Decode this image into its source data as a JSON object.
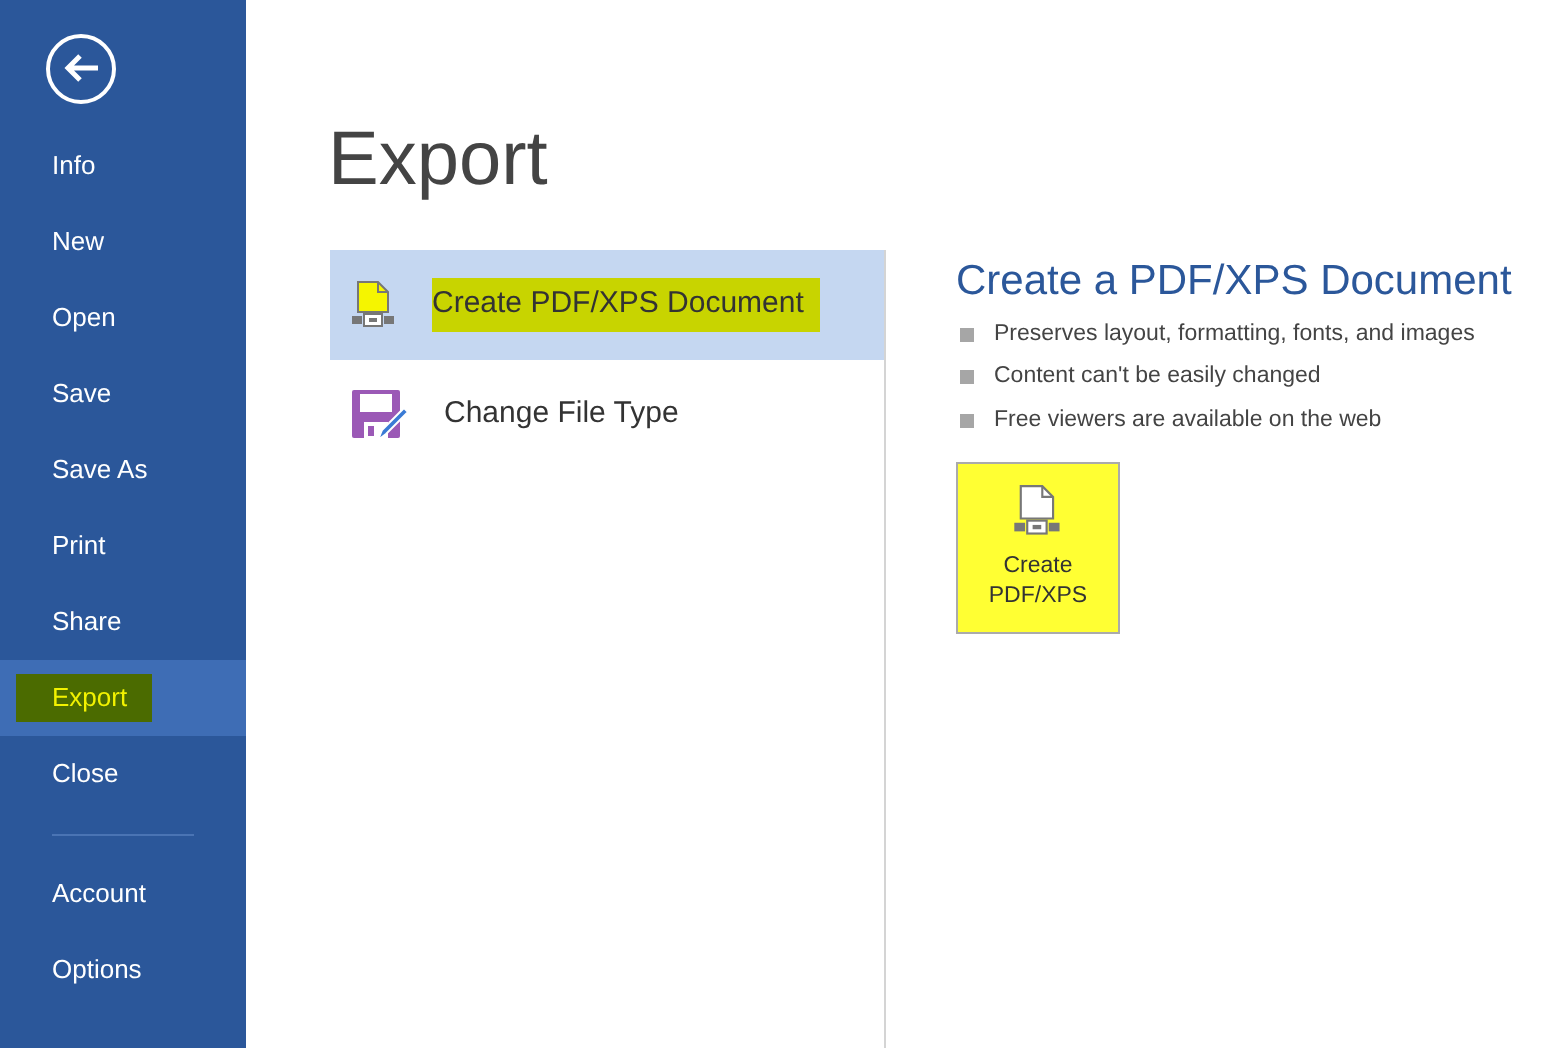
{
  "sidebar": {
    "items": [
      {
        "label": "Info",
        "selected": false,
        "highlighted": false
      },
      {
        "label": "New",
        "selected": false,
        "highlighted": false
      },
      {
        "label": "Open",
        "selected": false,
        "highlighted": false
      },
      {
        "label": "Save",
        "selected": false,
        "highlighted": false
      },
      {
        "label": "Save As",
        "selected": false,
        "highlighted": false
      },
      {
        "label": "Print",
        "selected": false,
        "highlighted": false
      },
      {
        "label": "Share",
        "selected": false,
        "highlighted": false
      },
      {
        "label": "Export",
        "selected": true,
        "highlighted": true
      },
      {
        "label": "Close",
        "selected": false,
        "highlighted": false
      }
    ],
    "bottom_items": [
      {
        "label": "Account",
        "selected": false,
        "highlighted": false
      },
      {
        "label": "Options",
        "selected": false,
        "highlighted": false
      }
    ]
  },
  "page_title": "Export",
  "options": [
    {
      "label": "Create PDF/XPS Document",
      "selected": true,
      "highlighted": true,
      "kind": "pdf"
    },
    {
      "label": "Change File Type",
      "selected": false,
      "highlighted": false,
      "kind": "filetype"
    }
  ],
  "detail": {
    "title": "Create a PDF/XPS Document",
    "bullets": [
      "Preserves layout, formatting, fonts, and images",
      "Content can't be easily changed",
      "Free viewers are available on the web"
    ],
    "button": {
      "label_lines": [
        "Create",
        "PDF/XPS"
      ],
      "highlighted": true
    }
  }
}
